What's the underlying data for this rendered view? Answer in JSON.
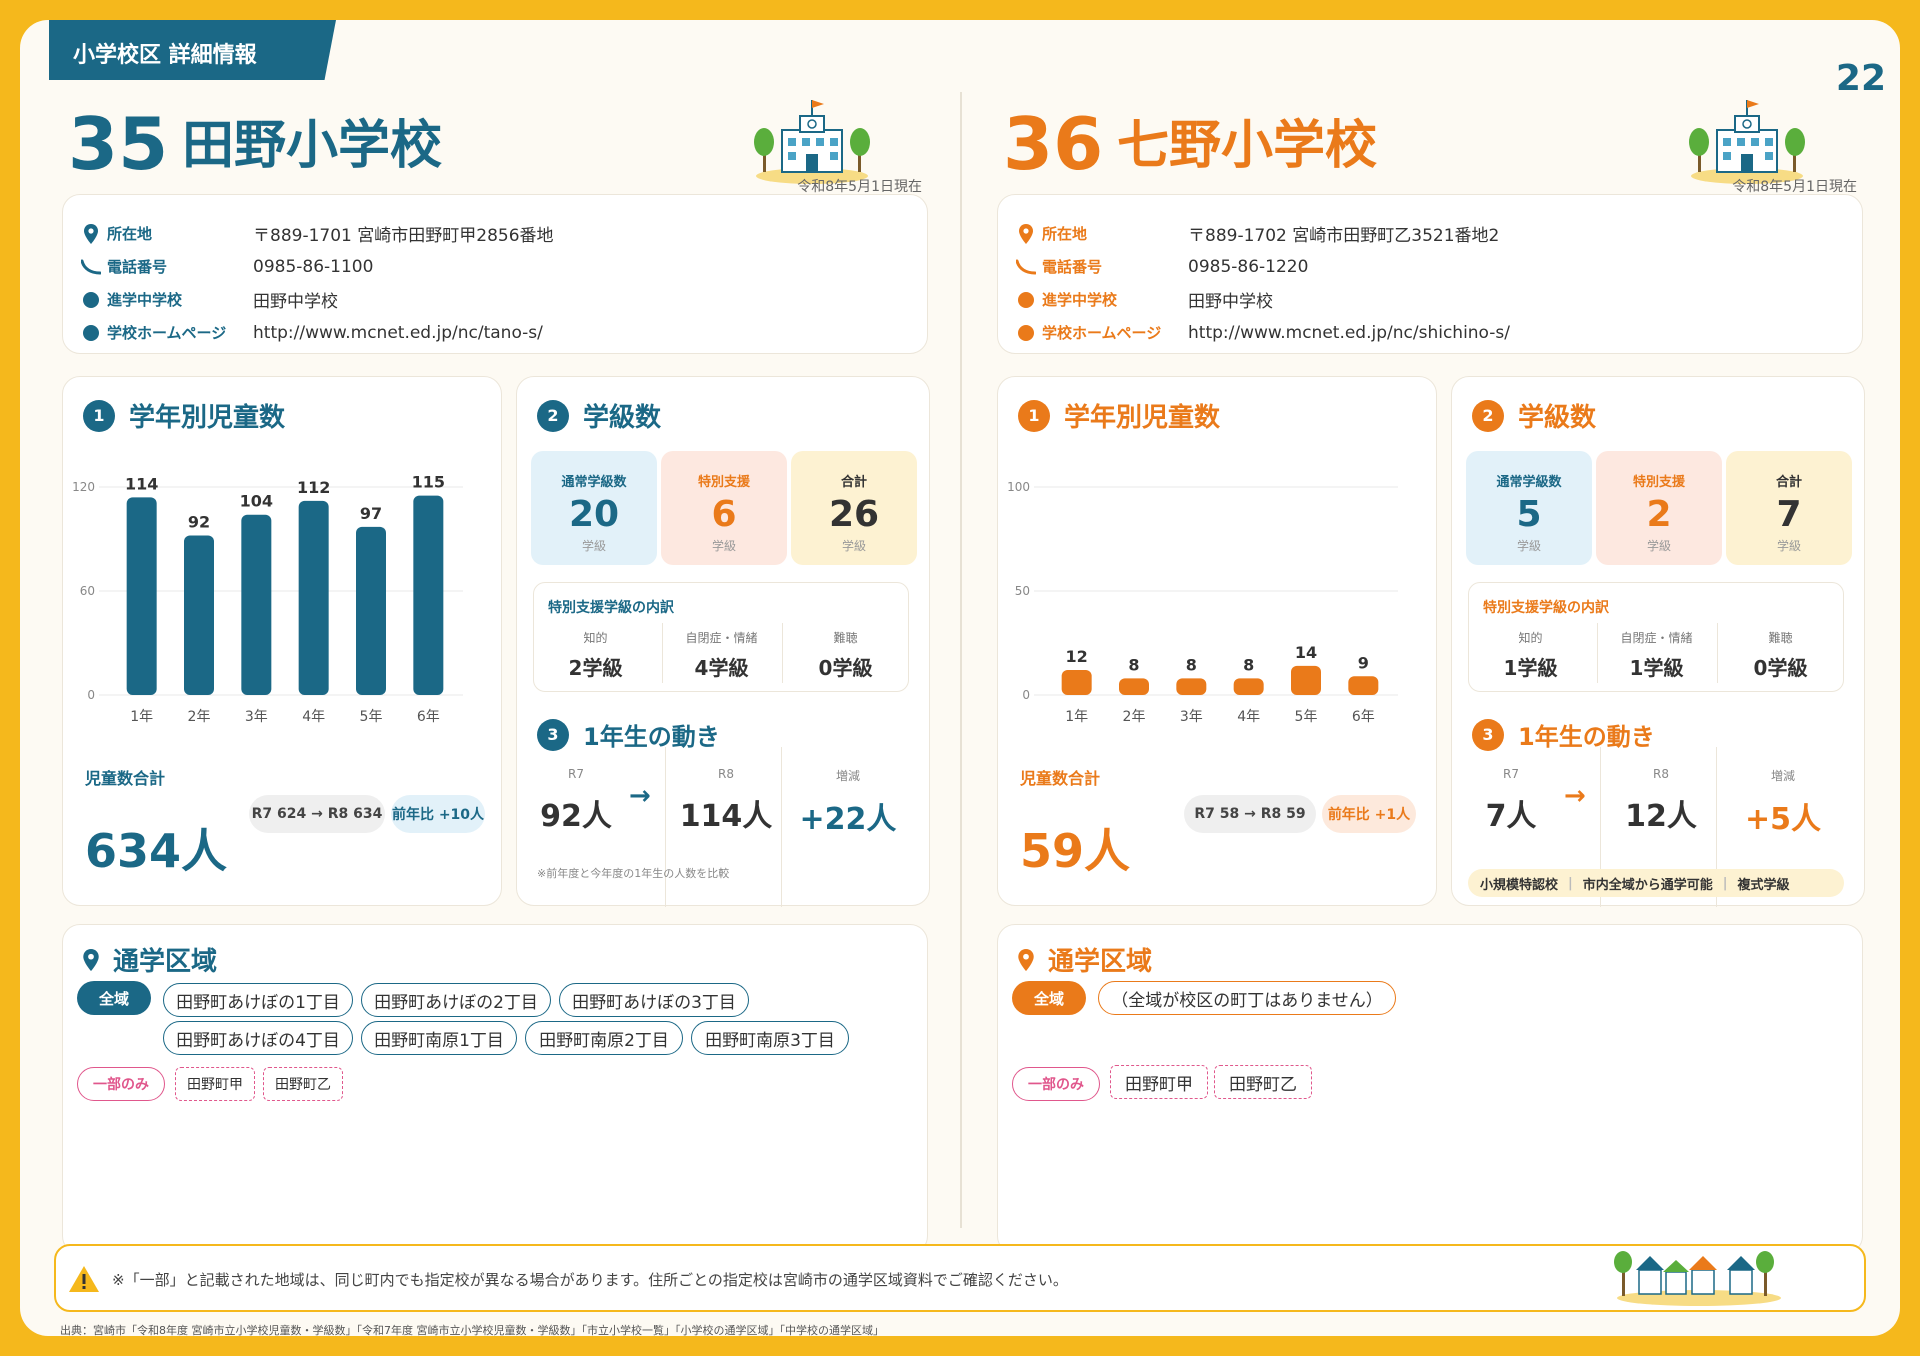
{
  "page": {
    "section_tag": "小学校区 詳細情報",
    "page_number": "22",
    "footer_note": "※「一部」と記載された地域は、同じ町内でも指定校が異なる場合があります。住所ごとの指定校は宮崎市の通学区域資料でご確認ください。",
    "source": "出典：宮崎市「令和8年度 宮崎市立小学校児童数・学級数」「令和7年度 宮崎市立小学校児童数・学級数」「市立小学校一覧」「小学校の通学区域」「中学校の通学区域」",
    "colors": {
      "teal": "#1b6886",
      "orange": "#ea7a1a",
      "frame": "#f5b81c"
    }
  },
  "schools": [
    {
      "number": "35",
      "name": "田野小学校",
      "date": "令和8年5月1日現在",
      "info": [
        {
          "icon": "location-pin-icon",
          "label": "所在地",
          "value": "〒889-1701 宮崎市田野町甲2856番地"
        },
        {
          "icon": "phone-icon",
          "label": "電話番号",
          "value": "0985-86-1100"
        },
        {
          "icon": "dot-icon",
          "label": "進学中学校",
          "value": "田野中学校"
        },
        {
          "icon": "dot-icon",
          "label": "学校ホームページ",
          "value": "http://www.mcnet.ed.jp/nc/tano-s/"
        }
      ],
      "grade_title": "学年別児童数",
      "grade_badge": "1",
      "chart_data": {
        "type": "bar",
        "categories": [
          "1年",
          "2年",
          "3年",
          "4年",
          "5年",
          "6年"
        ],
        "values": [
          114,
          92,
          104,
          112,
          97,
          115
        ],
        "yticks": [
          0,
          60,
          120
        ],
        "ylim": [
          0,
          120
        ],
        "title": "学年別児童数"
      },
      "total_label": "児童数合計",
      "total_value": "634人",
      "chip_change": "R7 624 → R8 634",
      "chip_yoy": "前年比 +10人",
      "class_title": "学級数",
      "class_badge": "2",
      "class_stats": [
        {
          "label": "通常学級数",
          "value": "20",
          "unit": "学級"
        },
        {
          "label": "特別支援",
          "value": "6",
          "unit": "学級"
        },
        {
          "label": "合計",
          "value": "26",
          "unit": "学級"
        }
      ],
      "breakdown_title": "特別支援学級の内訳",
      "breakdown": [
        {
          "label": "知的",
          "value": "2学級"
        },
        {
          "label": "自閉症・情緒",
          "value": "4学級"
        },
        {
          "label": "難聴",
          "value": "0学級"
        }
      ],
      "move_title": "1年生の動き",
      "move_badge": "3",
      "move": [
        {
          "label": "R7",
          "value": "92人"
        },
        {
          "label": "R8",
          "value": "114人"
        },
        {
          "label": "増減",
          "value": "+22人"
        }
      ],
      "move_note": "※前年度と今年度の1年生の人数を比較",
      "tags": [],
      "area_title": "通学区域",
      "area_all_label": "全域",
      "area_all": [
        "田野町あけぼの1丁目",
        "田野町あけぼの2丁目",
        "田野町あけぼの3丁目",
        "田野町あけぼの4丁目",
        "田野町南原1丁目",
        "田野町南原2丁目",
        "田野町南原3丁目"
      ],
      "area_part_label": "一部のみ",
      "area_part": [
        "田野町甲",
        "田野町乙"
      ]
    },
    {
      "number": "36",
      "name": "七野小学校",
      "date": "令和8年5月1日現在",
      "info": [
        {
          "icon": "location-pin-icon",
          "label": "所在地",
          "value": "〒889-1702 宮崎市田野町乙3521番地2"
        },
        {
          "icon": "phone-icon",
          "label": "電話番号",
          "value": "0985-86-1220"
        },
        {
          "icon": "dot-icon",
          "label": "進学中学校",
          "value": "田野中学校"
        },
        {
          "icon": "dot-icon",
          "label": "学校ホームページ",
          "value": "http://www.mcnet.ed.jp/nc/shichino-s/"
        }
      ],
      "grade_title": "学年別児童数",
      "grade_badge": "1",
      "chart_data": {
        "type": "bar",
        "categories": [
          "1年",
          "2年",
          "3年",
          "4年",
          "5年",
          "6年"
        ],
        "values": [
          12,
          8,
          8,
          8,
          14,
          9
        ],
        "yticks": [
          0,
          50,
          100
        ],
        "ylim": [
          0,
          100
        ],
        "title": "学年別児童数"
      },
      "total_label": "児童数合計",
      "total_value": "59人",
      "chip_change": "R7 58 → R8 59",
      "chip_yoy": "前年比 +1人",
      "class_title": "学級数",
      "class_badge": "2",
      "class_stats": [
        {
          "label": "通常学級数",
          "value": "5",
          "unit": "学級"
        },
        {
          "label": "特別支援",
          "value": "2",
          "unit": "学級"
        },
        {
          "label": "合計",
          "value": "7",
          "unit": "学級"
        }
      ],
      "breakdown_title": "特別支援学級の内訳",
      "breakdown": [
        {
          "label": "知的",
          "value": "1学級"
        },
        {
          "label": "自閉症・情緒",
          "value": "1学級"
        },
        {
          "label": "難聴",
          "value": "0学級"
        }
      ],
      "move_title": "1年生の動き",
      "move_badge": "3",
      "move": [
        {
          "label": "R7",
          "value": "7人"
        },
        {
          "label": "R8",
          "value": "12人"
        },
        {
          "label": "増減",
          "value": "+5人"
        }
      ],
      "move_note": "",
      "tags": [
        "小規模特認校",
        "市内全域から通学可能",
        "複式学級"
      ],
      "area_title": "通学区域",
      "area_all_label": "全域",
      "area_all": [
        "（全域が校区の町丁はありません）"
      ],
      "area_part_label": "一部のみ",
      "area_part": [
        "田野町甲",
        "田野町乙"
      ]
    }
  ]
}
